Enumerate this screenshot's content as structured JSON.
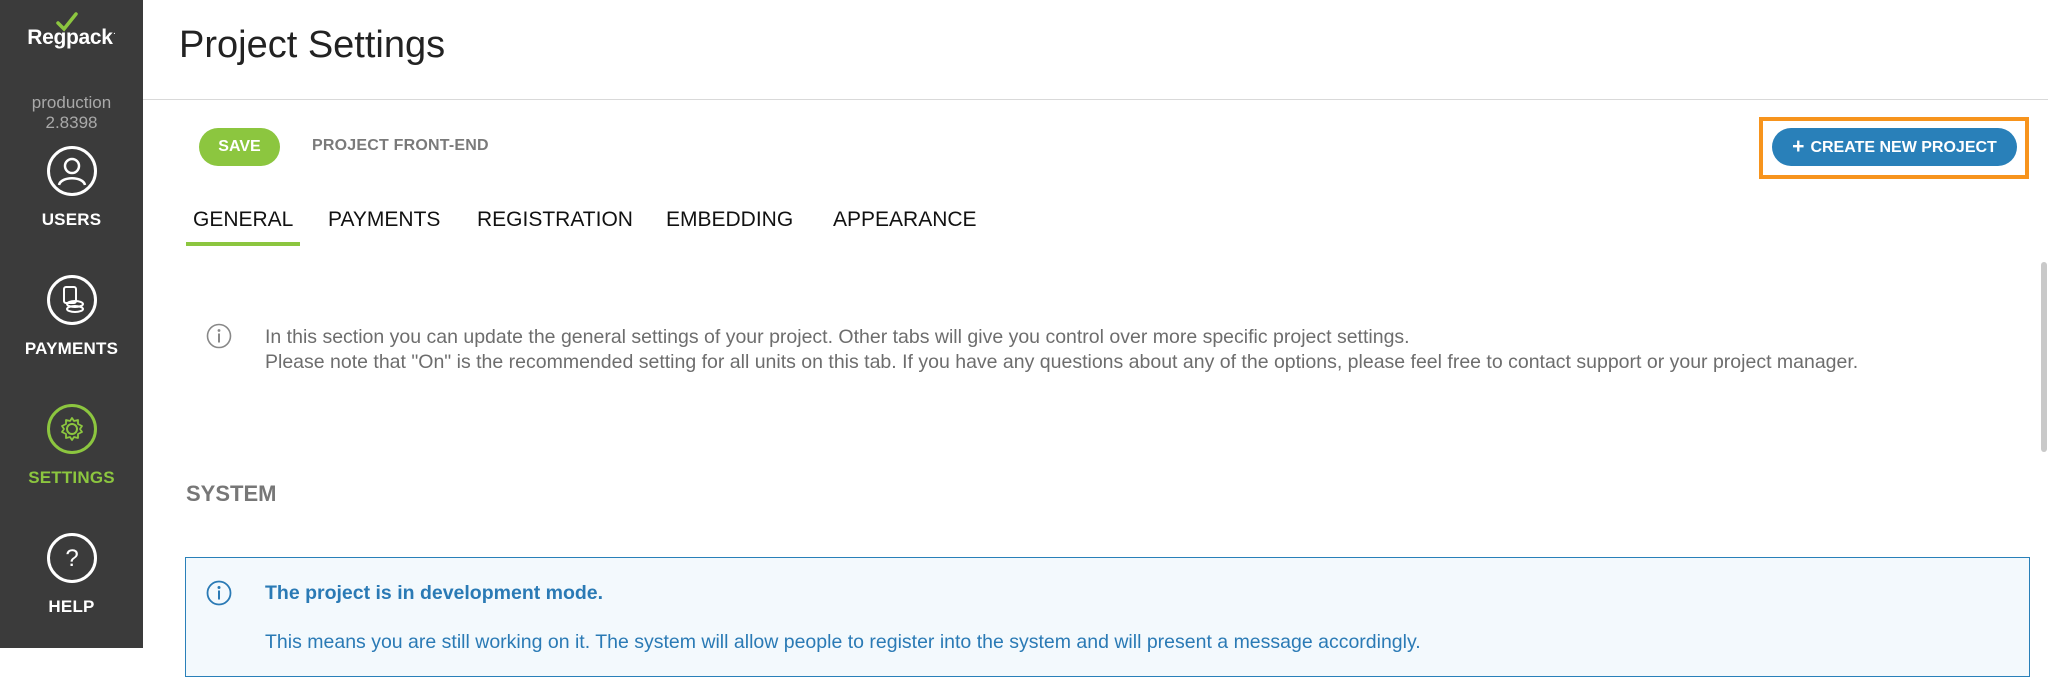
{
  "app": {
    "logo_text": "Regpack",
    "environment": "production",
    "version": "2.8398"
  },
  "sidebar": {
    "items": [
      {
        "label": "USERS",
        "icon": "user-icon"
      },
      {
        "label": "PAYMENTS",
        "icon": "coins-icon"
      },
      {
        "label": "SETTINGS",
        "icon": "gear-icon",
        "active": true
      },
      {
        "label": "HELP",
        "icon": "question-icon"
      }
    ]
  },
  "header": {
    "title": "Project Settings"
  },
  "toolbar": {
    "save_label": "SAVE",
    "frontend_label": "PROJECT FRONT-END",
    "create_label": "CREATE NEW PROJECT"
  },
  "tabs": [
    {
      "label": "GENERAL",
      "active": true
    },
    {
      "label": "PAYMENTS"
    },
    {
      "label": "REGISTRATION"
    },
    {
      "label": "EMBEDDING"
    },
    {
      "label": "APPEARANCE"
    }
  ],
  "info": {
    "line1": "In this section you can update the general settings of your project. Other tabs will give you control over more specific project settings.",
    "line2": "Please note that \"On\" is the recommended setting for all units on this tab. If you have any questions about any of the options, please feel free to contact support or your project manager."
  },
  "section": {
    "heading": "SYSTEM"
  },
  "notice": {
    "title": "The project is in development mode.",
    "body": "This means you are still working on it. The system will allow people to register into the system and will present a message accordingly."
  },
  "colors": {
    "sidebar_bg": "#3b3b3b",
    "accent_green": "#8cc63f",
    "accent_blue": "#2980b9",
    "highlight_orange": "#f7941d"
  }
}
